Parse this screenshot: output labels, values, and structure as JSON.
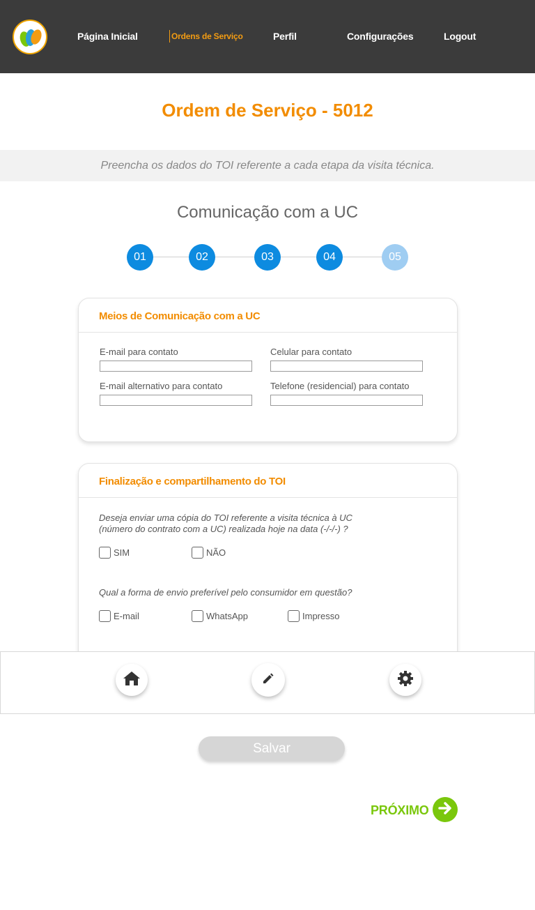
{
  "header": {
    "logo_icon": "company-leaf-logo",
    "nav": [
      {
        "label": "Página Inicial"
      },
      {
        "label": "Ordens de Serviço"
      },
      {
        "label": "Perfil"
      },
      {
        "label": "Configurações"
      },
      {
        "label": "Logout"
      }
    ],
    "active_nav": "Ordens de Serviço"
  },
  "page": {
    "title": "Ordem de Serviço - 5012",
    "subtitle": "Preencha os dados do TOI referente a cada etapa da visita técnica.",
    "section_title": "Comunicação com a UC"
  },
  "steps": {
    "items": [
      "01",
      "02",
      "03",
      "04",
      "05"
    ],
    "current": "05"
  },
  "contact_card": {
    "title": "Meios de Comunicação com a UC",
    "fields": [
      {
        "label": "E-mail para contato",
        "value": ""
      },
      {
        "label": "Celular para contato",
        "value": ""
      },
      {
        "label": "E-mail alternativo para contato",
        "value": ""
      },
      {
        "label": "Telefone (residencial) para contato",
        "value": ""
      }
    ]
  },
  "finalize_card": {
    "title": "Finalização e compartilhamento do TOI",
    "question1_line1": "Deseja enviar uma cópia do TOI referente a visita técnica à UC",
    "question1_line2": "(número do contrato com a UC) realizada hoje na data (-/-/-) ?",
    "options1": [
      "SIM",
      "NÃO"
    ],
    "question2": "Qual a forma de envio preferível pelo consumidor em questão?",
    "options2": [
      "E-mail",
      "WhatsApp",
      "Impresso"
    ]
  },
  "toolbar": {
    "icons": [
      "home-icon",
      "pencil-icon",
      "gear-icon"
    ]
  },
  "actions": {
    "save_label": "Salvar",
    "next_label": "PRÓXIMO"
  },
  "colors": {
    "header_bg": "#3b3b3b",
    "accent_orange": "#f28c00",
    "step_blue": "#0d8be0",
    "step_blue_light": "#9fcdf2",
    "next_green": "#7ac70c"
  }
}
